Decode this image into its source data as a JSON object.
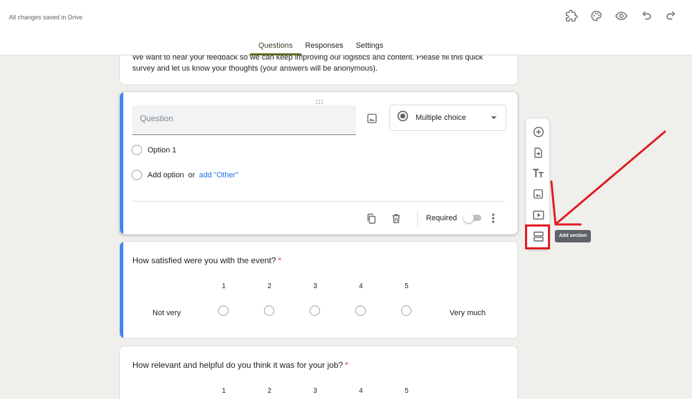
{
  "header": {
    "save_status": "All changes saved in Drive",
    "icons": [
      "addon-puzzle-icon",
      "palette-icon",
      "preview-eye-icon",
      "undo-icon",
      "redo-icon"
    ],
    "tabs": [
      {
        "label": "Questions",
        "active": true
      },
      {
        "label": "Responses",
        "active": false
      },
      {
        "label": "Settings",
        "active": false
      }
    ]
  },
  "description": {
    "text": "We want to hear your feedback so we can keep improving our logistics and content. Please fill this quick survey and let us know your thoughts (your answers will be anonymous)."
  },
  "question_editor": {
    "placeholder": "Question",
    "type": "Multiple choice",
    "option1": "Option 1",
    "add_option": "Add option",
    "or_text": "or",
    "add_other": "add \"Other\"",
    "required_label": "Required",
    "required": false
  },
  "scale_question_1": {
    "title": "How satisfied were you with the event?",
    "required_mark": "*",
    "scale": [
      "1",
      "2",
      "3",
      "4",
      "5"
    ],
    "low_label": "Not very",
    "high_label": "Very much"
  },
  "scale_question_2": {
    "title": "How relevant and helpful do you think it was for your job?",
    "required_mark": "*",
    "scale": [
      "1",
      "2",
      "3",
      "4",
      "5"
    ]
  },
  "toolbar": {
    "items": [
      "add-question-icon",
      "import-questions-icon",
      "add-title-icon",
      "add-image-icon",
      "add-video-icon",
      "add-section-icon"
    ],
    "tooltip": "Add section"
  },
  "colors": {
    "accent": "#4285f4",
    "tab_underline": "#5d6b1d",
    "highlight": "#e11b22",
    "required": "#d93025"
  }
}
